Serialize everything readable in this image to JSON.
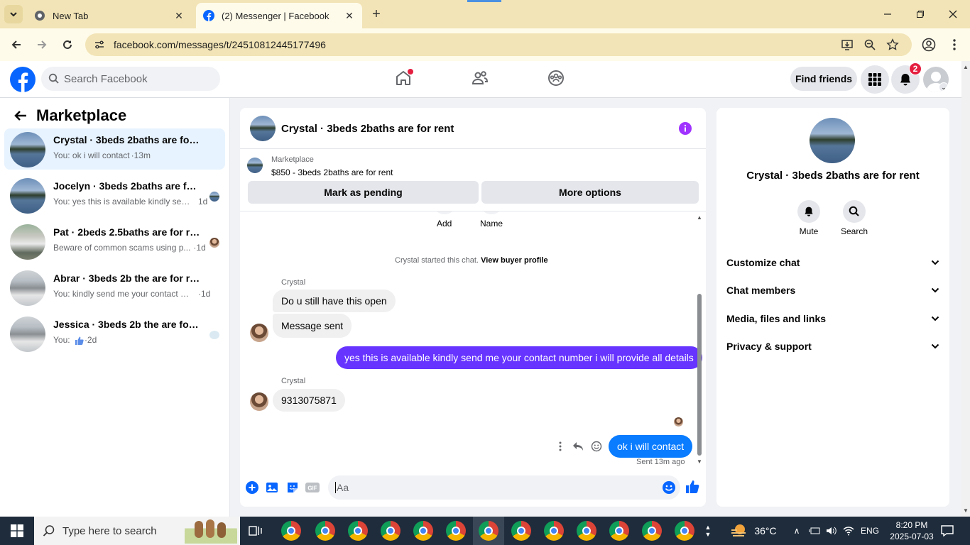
{
  "browser": {
    "tabs": [
      {
        "title": "New Tab",
        "active": false
      },
      {
        "title": "(2) Messenger | Facebook",
        "active": true
      }
    ],
    "url": "facebook.com/messages/t/24510812445177496"
  },
  "fb_header": {
    "search_placeholder": "Search Facebook",
    "find_friends": "Find friends",
    "notification_count": "2"
  },
  "left_panel": {
    "title": "Marketplace",
    "conversations": [
      {
        "name": "Crystal · 3beds 2baths are for rent",
        "preview": "You: ok i will contact",
        "time": "·13m",
        "active": true,
        "avatar": "lake"
      },
      {
        "name": "Jocelyn · 3beds 2baths are for re...",
        "preview": "You: yes this is available kindly sen...",
        "time": "1d",
        "active": false,
        "avatar": "lake"
      },
      {
        "name": "Pat · 2beds 2.5baths are for rent",
        "preview": "Beware of common scams using p...",
        "time": "·1d",
        "active": false,
        "avatar": "house2"
      },
      {
        "name": "Abrar · 3beds 2b the are for rent",
        "preview": "You: kindly send me your contact nu...",
        "time": "·1d",
        "active": false,
        "avatar": "house"
      },
      {
        "name": "Jessica · 3beds 2b the are for rent",
        "preview": "You:",
        "time": "·2d",
        "active": false,
        "avatar": "house"
      }
    ]
  },
  "chat": {
    "title": "Crystal · 3beds 2baths are for rent",
    "listing_source": "Marketplace",
    "listing_price_title": "$850 - 3beds 2baths are for rent",
    "mark_pending": "Mark as pending",
    "more_options": "More options",
    "top_actions": [
      "Add",
      "Name"
    ],
    "started_text": "Crystal started this chat.",
    "view_profile": "View buyer profile",
    "sender_name": "Crystal",
    "messages": {
      "m1": "Do u still have this open",
      "m2": "Message sent",
      "m3": "yes this is available kindly send me your contact number i will provide all  details",
      "m4": "9313075871",
      "m5": "ok i will contact"
    },
    "sent_status": "Sent 13m ago",
    "composer_placeholder": "Aa"
  },
  "right_panel": {
    "title": "Crystal · 3beds 2baths are for rent",
    "mute": "Mute",
    "search": "Search",
    "sections": [
      "Customize chat",
      "Chat members",
      "Media, files and links",
      "Privacy & support"
    ]
  },
  "taskbar": {
    "search_placeholder": "Type here to search",
    "temperature": "36°C",
    "language": "ENG",
    "time": "8:20 PM",
    "date": "2025-07-03"
  },
  "colors": {
    "fb_blue": "#0866ff",
    "outgoing_purple": "#6633ff",
    "outgoing_blue": "#0a7cff",
    "info_purple": "#a033ff"
  }
}
